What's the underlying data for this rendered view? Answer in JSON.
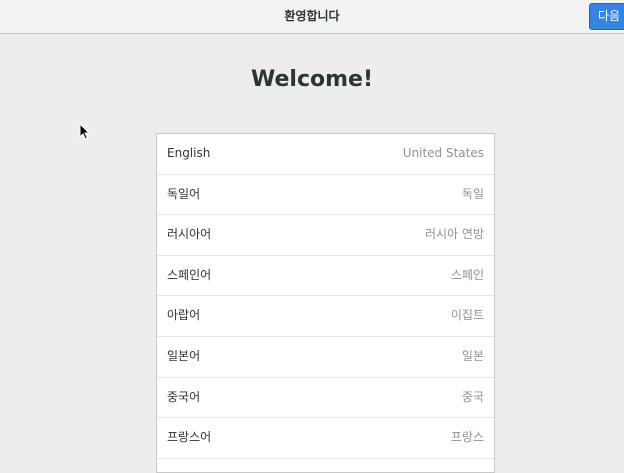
{
  "header": {
    "title": "환영합니다",
    "next_label": "다음"
  },
  "main": {
    "welcome": "Welcome!",
    "languages": [
      {
        "name": "English",
        "region": "United States"
      },
      {
        "name": "독일어",
        "region": "독일"
      },
      {
        "name": "러시아어",
        "region": "러시아 연방"
      },
      {
        "name": "스페인어",
        "region": "스페인"
      },
      {
        "name": "아랍어",
        "region": "이집트"
      },
      {
        "name": "일본어",
        "region": "일본"
      },
      {
        "name": "중국어",
        "region": "중국"
      },
      {
        "name": "프랑스어",
        "region": "프랑스"
      }
    ]
  },
  "colors": {
    "accent": "#3584e4",
    "background": "#ededed"
  },
  "icons": {
    "cursor": "mouse-pointer-icon"
  }
}
